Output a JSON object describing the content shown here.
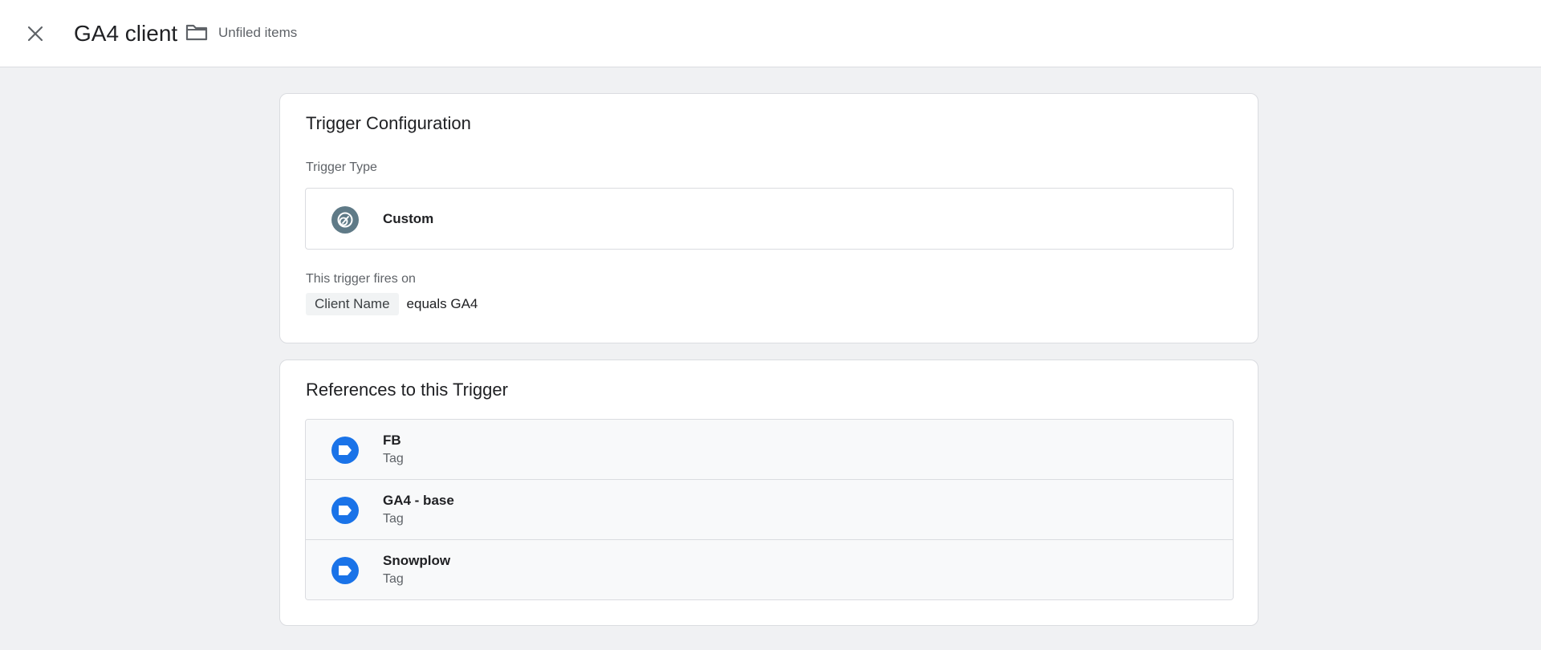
{
  "header": {
    "title": "GA4 client",
    "folder_label": "Unfiled items"
  },
  "trigger_configuration": {
    "title": "Trigger Configuration",
    "type_label": "Trigger Type",
    "type_value": "Custom",
    "fires_on_label": "This trigger fires on",
    "condition": {
      "variable": "Client Name",
      "operator_value": "equals GA4"
    }
  },
  "references": {
    "title": "References to this Trigger",
    "items": [
      {
        "name": "FB",
        "type": "Tag"
      },
      {
        "name": "GA4 - base",
        "type": "Tag"
      },
      {
        "name": "Snowplow",
        "type": "Tag"
      }
    ]
  },
  "colors": {
    "background": "#f0f1f3",
    "custom_icon": "#5f7a87",
    "tag_icon": "#1a73e8"
  },
  "icons": {
    "close": "close-icon",
    "folder": "folder-icon",
    "trigger_type": "custom-trigger-icon",
    "tag": "tag-icon"
  }
}
